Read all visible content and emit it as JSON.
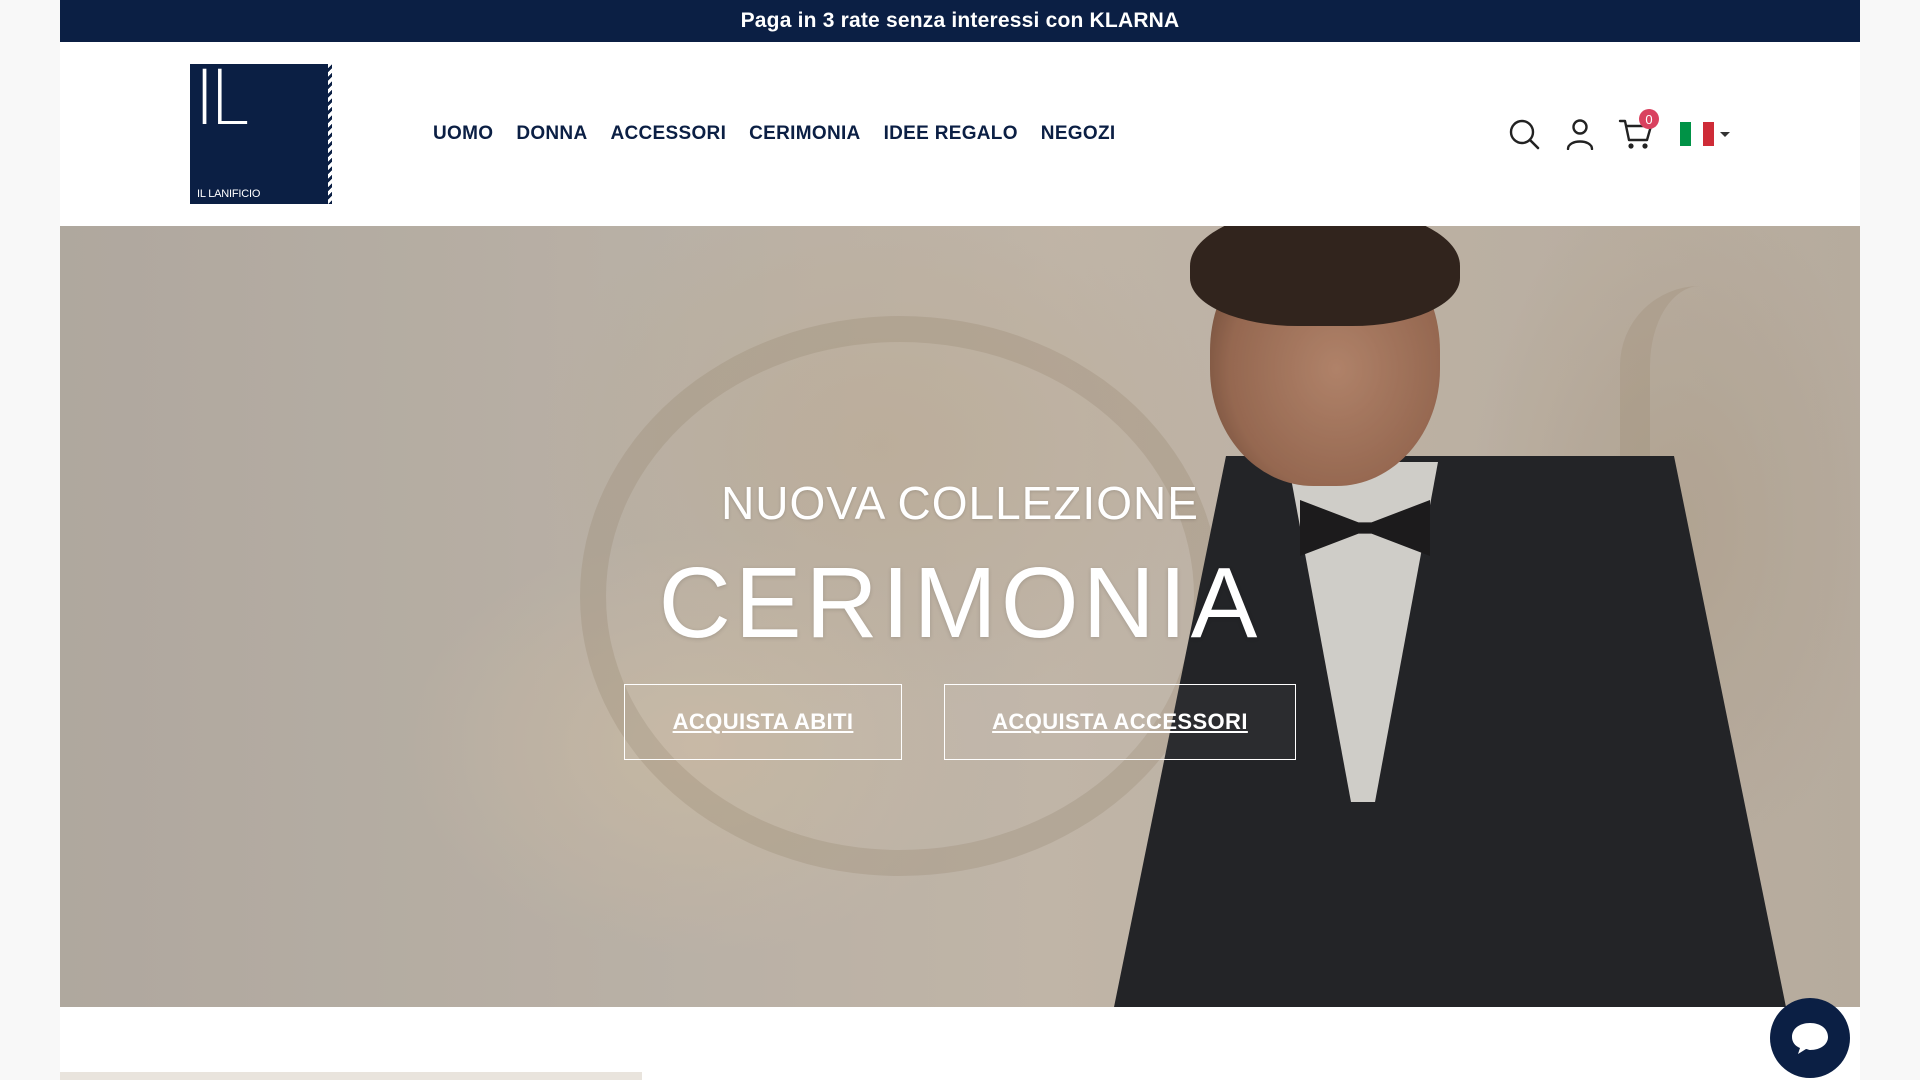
{
  "announcement": {
    "text": "Paga in 3 rate senza interessi con KLARNA"
  },
  "logo": {
    "monogram": "IL",
    "name": "IL LANIFICIO"
  },
  "nav": {
    "items": [
      {
        "label": "UOMO"
      },
      {
        "label": "DONNA"
      },
      {
        "label": "ACCESSORI"
      },
      {
        "label": "CERIMONIA"
      },
      {
        "label": "IDEE REGALO"
      },
      {
        "label": "NEGOZI"
      }
    ]
  },
  "header_icons": {
    "search": "search-icon",
    "account": "user-icon",
    "cart": "cart-icon",
    "cart_count": "0",
    "language": "italy-flag-icon"
  },
  "hero": {
    "subtitle": "NUOVA COLLEZIONE",
    "title": "CERIMONIA",
    "buttons": [
      {
        "label": "ACQUISTA ABITI"
      },
      {
        "label": "ACQUISTA ACCESSORI"
      }
    ]
  },
  "colors": {
    "brand": "#0b1f44",
    "badge": "#d9415f",
    "flag_green": "#009246",
    "flag_white": "#ffffff",
    "flag_red": "#ce2b37"
  },
  "chat": {
    "icon": "chat-bubble-icon"
  }
}
